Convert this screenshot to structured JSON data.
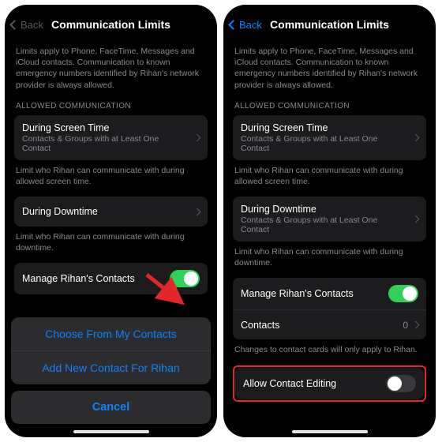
{
  "left": {
    "back": "Back",
    "title": "Communication Limits",
    "intro": "Limits apply to Phone, FaceTime, Messages and iCloud contacts. Communication to known emergency numbers identified by Rihan's network provider is always allowed.",
    "allowed_header": "ALLOWED COMMUNICATION",
    "screen_title": "During Screen Time",
    "screen_sub": "Contacts & Groups with at Least One Contact",
    "screen_note": "Limit who Rihan can communicate with during allowed screen time.",
    "down_title": "During Downtime",
    "down_note": "Limit who Rihan can communicate with during downtime.",
    "manage": "Manage Rihan's Contacts",
    "sheet_choose": "Choose From My Contacts",
    "sheet_add": "Add New Contact For Rihan",
    "sheet_cancel": "Cancel"
  },
  "right": {
    "back": "Back",
    "title": "Communication Limits",
    "intro": "Limits apply to Phone, FaceTime, Messages and iCloud contacts. Communication to known emergency numbers identified by Rihan's network provider is always allowed.",
    "allowed_header": "ALLOWED COMMUNICATION",
    "screen_title": "During Screen Time",
    "screen_sub": "Contacts & Groups with at Least One Contact",
    "screen_note": "Limit who Rihan can communicate with during allowed screen time.",
    "down_title": "During Downtime",
    "down_sub": "Contacts & Groups with at Least One Contact",
    "down_note": "Limit who Rihan can communicate with during downtime.",
    "manage": "Manage Rihan's Contacts",
    "contacts_label": "Contacts",
    "contacts_value": "0",
    "contacts_note": "Changes to contact cards will only apply to Rihan.",
    "allow_edit": "Allow Contact Editing"
  }
}
